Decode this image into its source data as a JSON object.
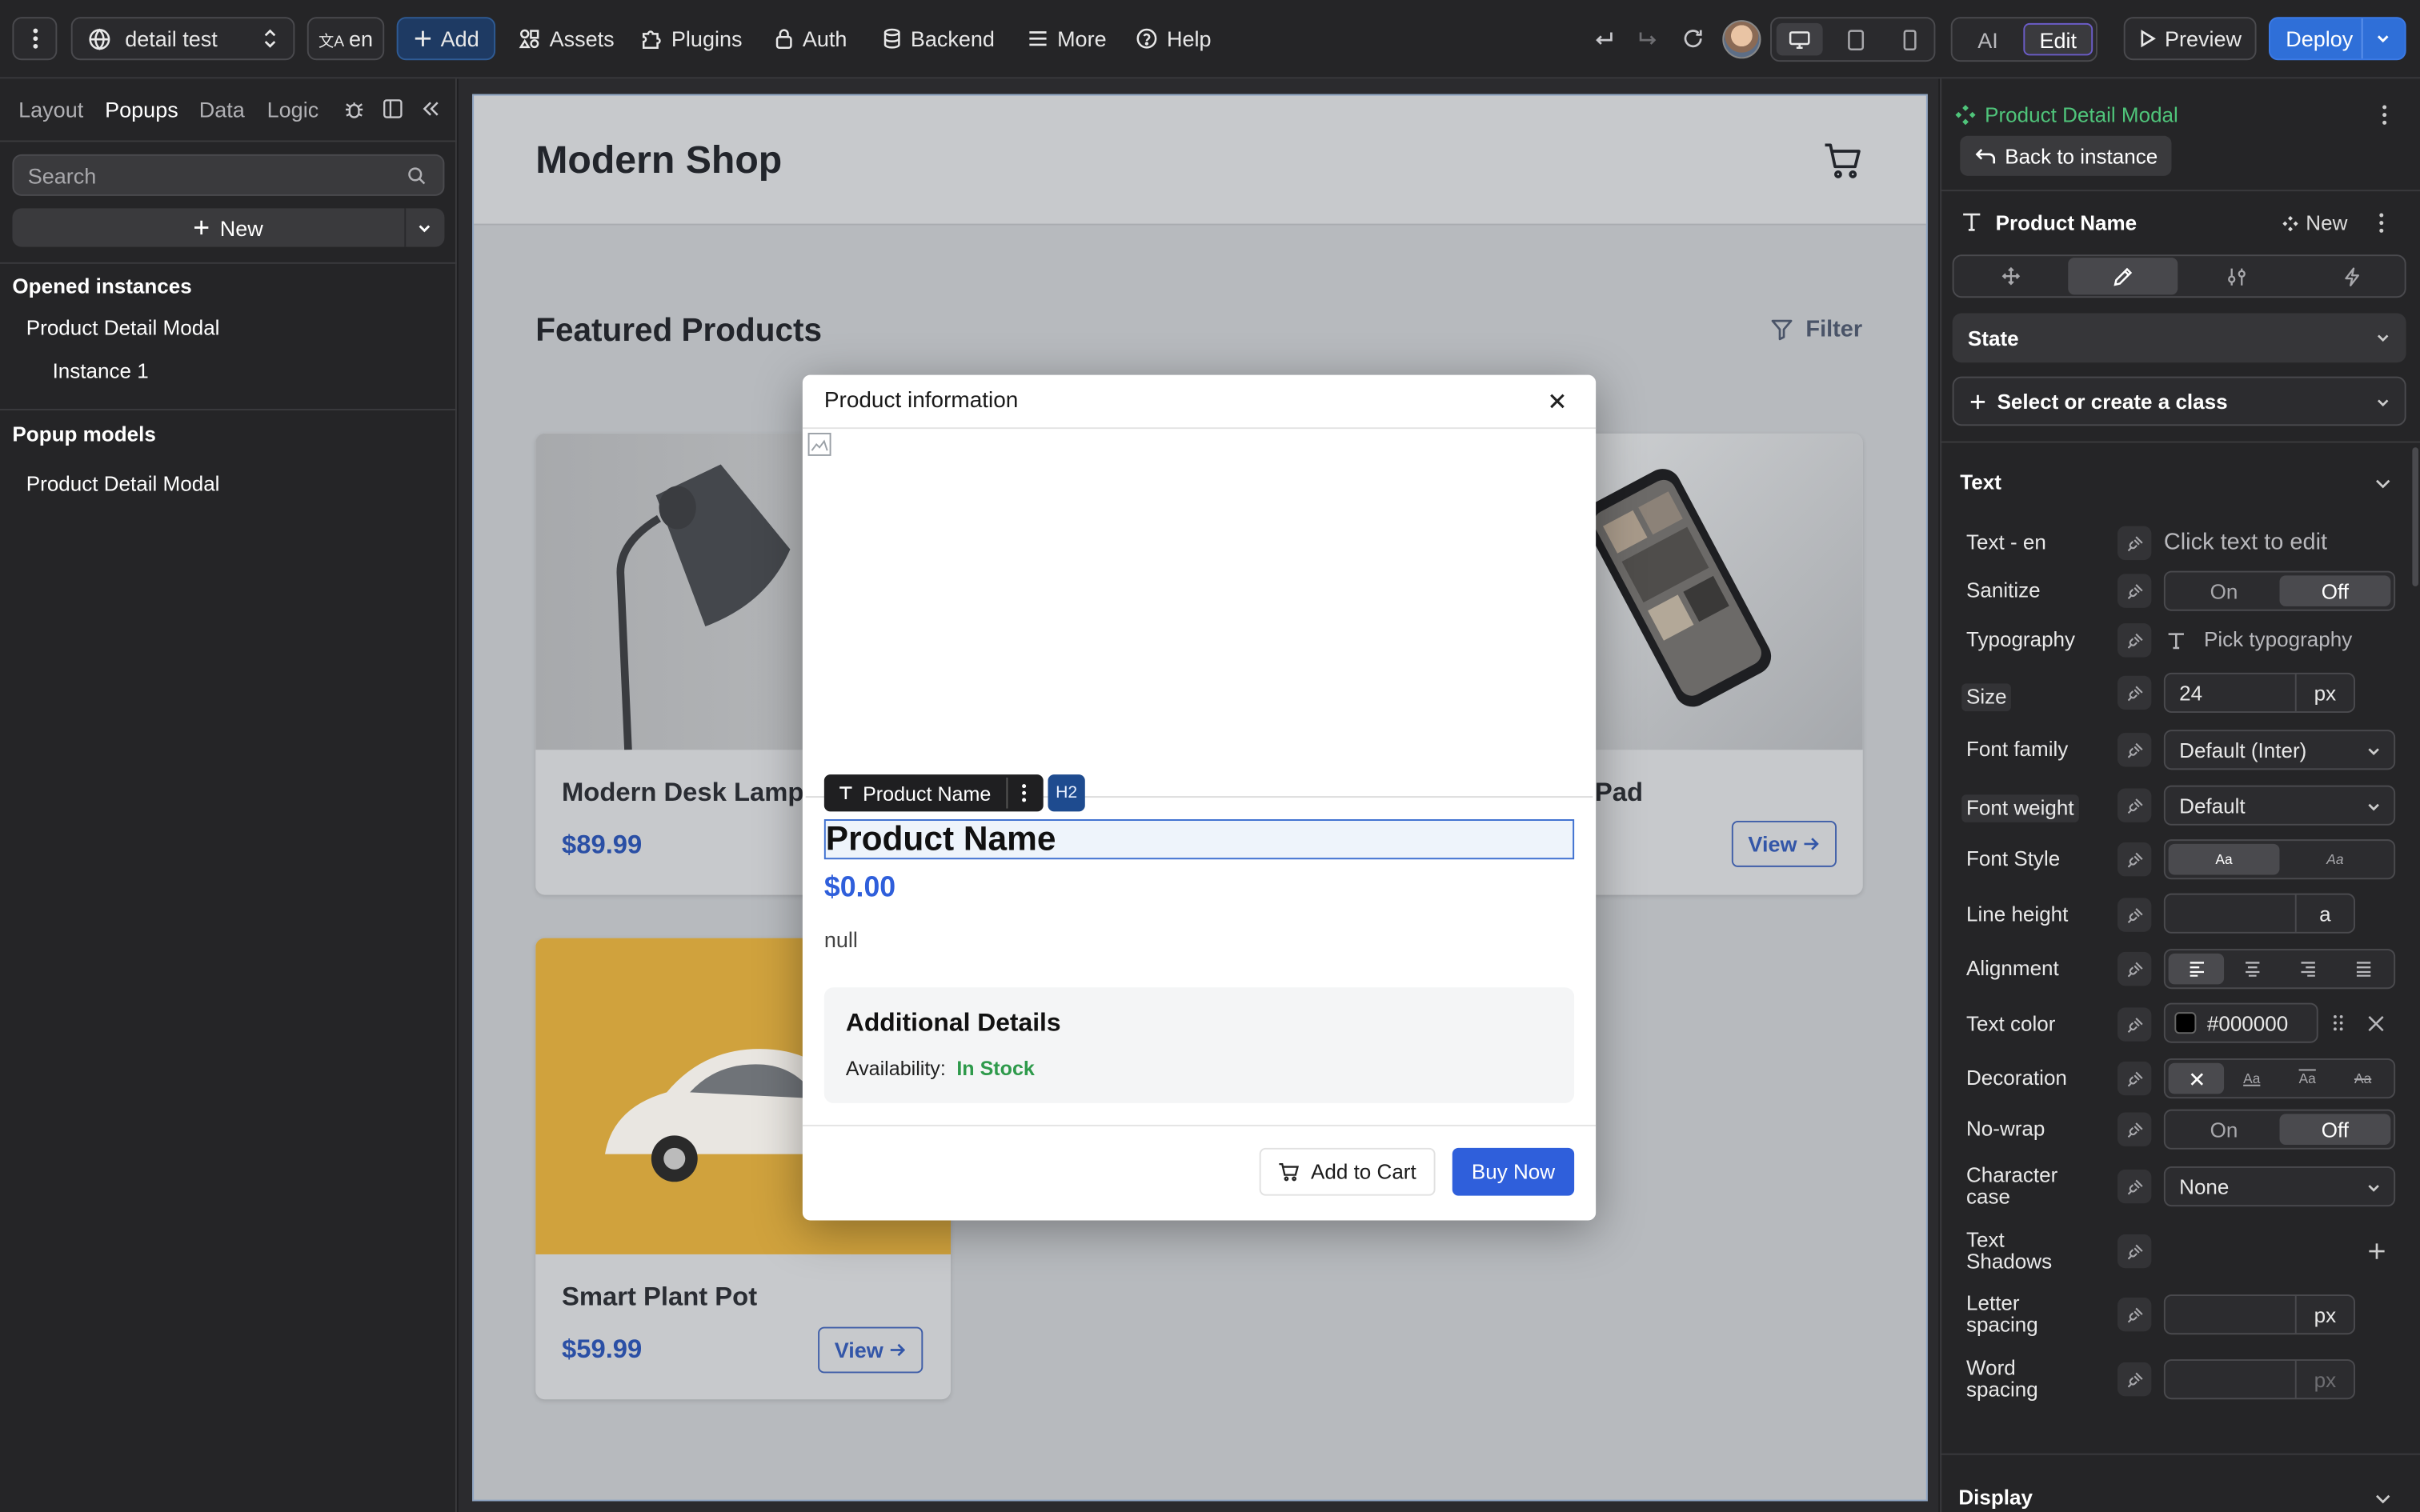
{
  "topbar": {
    "project_name": "detail test",
    "language": "en",
    "add_label": "Add",
    "assets_label": "Assets",
    "plugins_label": "Plugins",
    "auth_label": "Auth",
    "backend_label": "Backend",
    "more_label": "More",
    "help_label": "Help",
    "ai_label": "AI",
    "edit_label": "Edit",
    "preview_label": "Preview",
    "deploy_label": "Deploy",
    "accent_color": "#2f6fd8"
  },
  "left_panel": {
    "tabs": [
      "Layout",
      "Popups",
      "Data",
      "Logic"
    ],
    "active_tab": "Popups",
    "search_placeholder": "Search",
    "new_label": "New",
    "opened_instances_heading": "Opened instances",
    "opened_instances": [
      {
        "label": "Product Detail Modal"
      },
      {
        "label": "Instance 1"
      }
    ],
    "popup_models_heading": "Popup models",
    "popup_models": [
      {
        "label": "Product Detail Modal"
      }
    ]
  },
  "canvas": {
    "shop_title": "Modern Shop",
    "section_title": "Featured Products",
    "filter_label": "Filter",
    "cards": [
      {
        "title": "Modern Desk Lamp",
        "price": "$89.99"
      },
      {
        "title": "Charging Pad",
        "view_label": "View"
      },
      {
        "title": "Smart Plant Pot",
        "price": "$59.99",
        "view_label": "View"
      }
    ]
  },
  "modal": {
    "title": "Product information",
    "selection_tag": "Product Name",
    "selection_badge": "H2",
    "product_name": "Product Name",
    "price": "$0.00",
    "description": "null",
    "details_heading": "Additional Details",
    "availability_label": "Availability:",
    "availability_value": "In Stock",
    "availability_color": "#2e9a4b",
    "add_to_cart_label": "Add to Cart",
    "buy_now_label": "Buy Now",
    "buy_color": "#2f5fdb"
  },
  "right_panel": {
    "component_name": "Product Detail Modal",
    "component_color": "#4fc47a",
    "back_label": "Back to instance",
    "element_name": "Product Name",
    "new_label": "New",
    "state_label": "State",
    "class_label": "Select or create a class",
    "section_text": "Text",
    "rows": {
      "text_en": {
        "label": "Text - en",
        "value": "Click text to edit"
      },
      "sanitize": {
        "label": "Sanitize",
        "on": "On",
        "off": "Off",
        "selected": "Off"
      },
      "typography": {
        "label": "Typography",
        "value": "Pick typography"
      },
      "size": {
        "label": "Size",
        "value": "24",
        "unit": "px"
      },
      "font_family": {
        "label": "Font family",
        "value": "Default (Inter)"
      },
      "font_weight": {
        "label": "Font weight",
        "value": "Default"
      },
      "font_style": {
        "label": "Font Style",
        "opt1": "Aa",
        "opt2": "Aa"
      },
      "line_height": {
        "label": "Line height",
        "unit": "a"
      },
      "alignment": {
        "label": "Alignment"
      },
      "text_color": {
        "label": "Text color",
        "value": "#000000"
      },
      "decoration": {
        "label": "Decoration",
        "opts": [
          "Aa",
          "Aa",
          "Aa"
        ]
      },
      "no_wrap": {
        "label": "No-wrap",
        "on": "On",
        "off": "Off",
        "selected": "Off"
      },
      "character_case": {
        "label1": "Character",
        "label2": "case",
        "value": "None"
      },
      "text_shadows": {
        "label1": "Text",
        "label2": "Shadows"
      },
      "letter_spacing": {
        "label1": "Letter",
        "label2": "spacing",
        "unit": "px"
      },
      "word_spacing": {
        "label1": "Word",
        "label2": "spacing",
        "unit": "px"
      }
    },
    "section_display": "Display"
  }
}
